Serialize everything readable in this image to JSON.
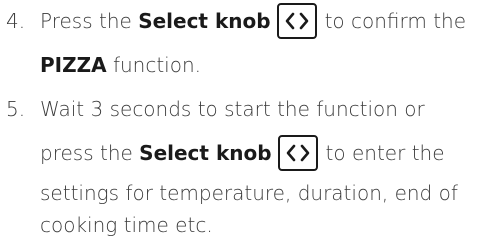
{
  "steps": [
    {
      "number": "4.",
      "line1_pre": "Press the ",
      "line1_bold": "Select knob",
      "line1_post": "to confirm the",
      "line2_bold": "PIZZA",
      "line2_post": " function."
    },
    {
      "number": "5.",
      "line1": "Wait 3 seconds to start the function or",
      "line2_pre": "press the ",
      "line2_bold": "Select knob",
      "line2_post": "to enter the",
      "line3": "settings for temperature, duration, end of",
      "line4": "cooking time etc."
    }
  ],
  "icons": {
    "knob": "select-knob-icon"
  }
}
